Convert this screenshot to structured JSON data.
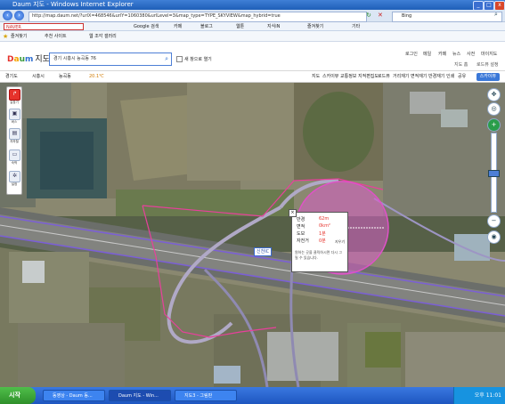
{
  "window": {
    "title": "Daum 지도 - Windows Internet Explorer",
    "minimize": "_",
    "maximize": "□",
    "close": "x"
  },
  "address": {
    "url": "http://map.daum.net/?urlX=468546&urlY=1060380&urlLevel=3&map_type=TYPE_SKYVIEW&map_hybrid=true",
    "search_placeholder": "Bing"
  },
  "toolbar": {
    "search_label": "NAVER",
    "items": [
      "Google 검색",
      "카페",
      "블로그",
      "웹툰",
      "지식iN",
      "즐겨찾기",
      "기타"
    ]
  },
  "favorites": {
    "label": "즐겨찾기",
    "items": [
      "추천 사이트",
      "웹 조각 갤러리"
    ]
  },
  "header": {
    "logo_d": "D",
    "logo_a": "a",
    "logo_u": "u",
    "logo_m": "m",
    "logo_title": "지도",
    "search_value": "경기 시흥시 능곡동 76",
    "checkbox_label": "새 창으로 열기",
    "links": [
      "로그인",
      "메일",
      "카페",
      "뉴스",
      "사전",
      "마이지도"
    ],
    "sub_links": [
      "지도 홈",
      "로드뷰 설정"
    ]
  },
  "map_toolbar": {
    "items": [
      "경기도",
      "시흥시",
      "능곡동",
      "20.1℃"
    ],
    "right_items": [
      "지도",
      "스카이뷰",
      "교통정보",
      "지적편집도",
      "로드뷰",
      "거리재기",
      "면적재기",
      "반경재기",
      "인쇄",
      "공유"
    ],
    "skyview": "스카이뷰"
  },
  "left_tools": {
    "items": [
      {
        "icon": "route",
        "label": "길찾기"
      },
      {
        "icon": "bus",
        "label": "버스"
      },
      {
        "icon": "subway",
        "label": "지하철"
      },
      {
        "icon": "bed",
        "label": "숙박"
      },
      {
        "icon": "gear",
        "label": "설정"
      }
    ]
  },
  "zoom": {
    "plus": "+",
    "minus": "−",
    "level": 3
  },
  "popup": {
    "rows": [
      {
        "label": "반경",
        "value": "62m"
      },
      {
        "label": "면적",
        "value": "0km²"
      },
      {
        "label": "도보",
        "value": "1분"
      },
      {
        "label": "자전거",
        "value": "0분"
      }
    ],
    "delete": "지우기",
    "hint": "원하는 곳을 클릭하시면 다시 그릴 수 있습니다."
  },
  "road_sign": "신천IC",
  "taskbar": {
    "start": "시작",
    "tasks": [
      "동영상 - Daum 동...",
      "Daum 지도 - Win...",
      "지도3 - 그림판"
    ],
    "clock": "오후 11:01"
  }
}
